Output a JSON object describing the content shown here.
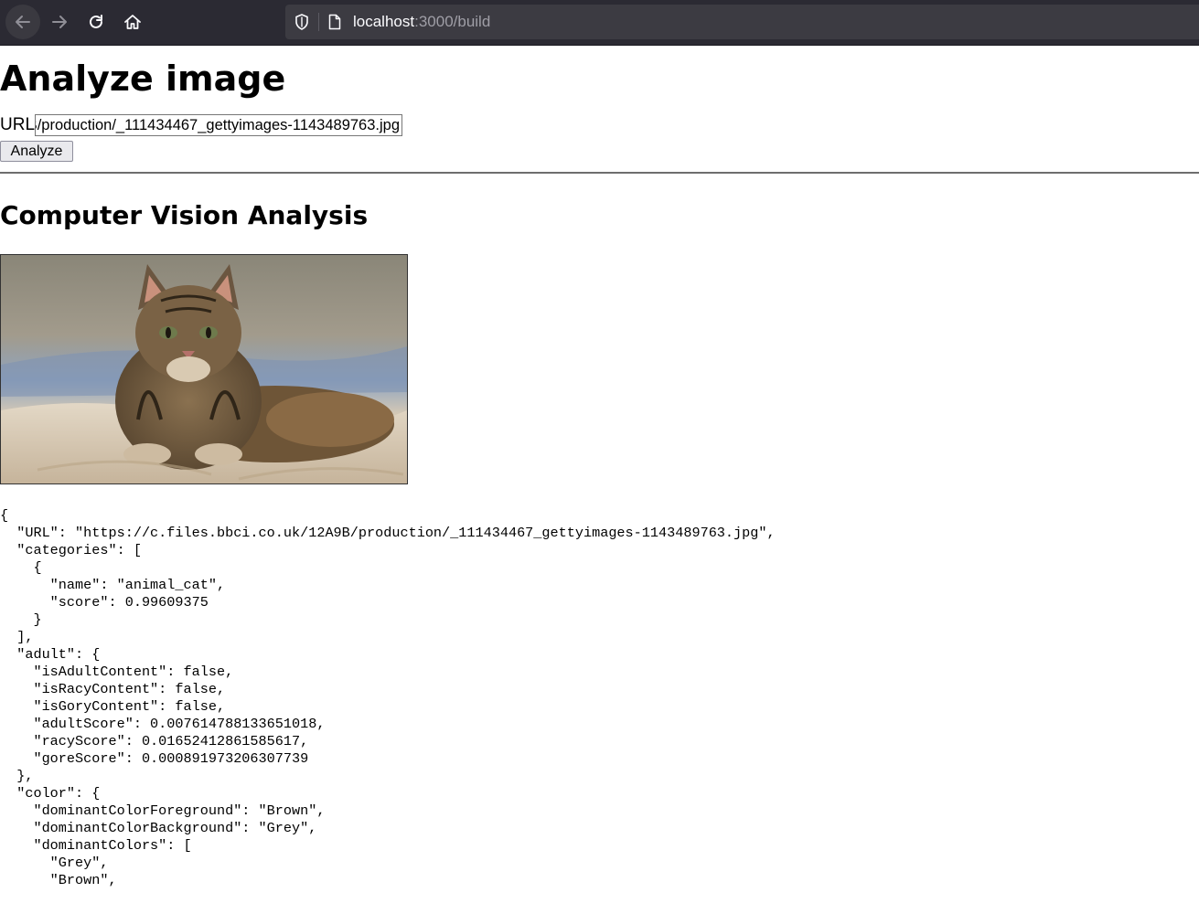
{
  "browser": {
    "url_host": "localhost",
    "url_rest": ":3000/build"
  },
  "page": {
    "title": "Analyze image",
    "url_label": "URL",
    "url_value": "https://c.files.bbci.co.uk/12A9B/production/_111434467_gettyimages-1143489763.jpg",
    "analyze_label": "Analyze",
    "section_title": "Computer Vision Analysis"
  },
  "result_json": "{\n  \"URL\": \"https://c.files.bbci.co.uk/12A9B/production/_111434467_gettyimages-1143489763.jpg\",\n  \"categories\": [\n    {\n      \"name\": \"animal_cat\",\n      \"score\": 0.99609375\n    }\n  ],\n  \"adult\": {\n    \"isAdultContent\": false,\n    \"isRacyContent\": false,\n    \"isGoryContent\": false,\n    \"adultScore\": 0.007614788133651018,\n    \"racyScore\": 0.01652412861585617,\n    \"goreScore\": 0.000891973206307739\n  },\n  \"color\": {\n    \"dominantColorForeground\": \"Brown\",\n    \"dominantColorBackground\": \"Grey\",\n    \"dominantColors\": [\n      \"Grey\",\n      \"Brown\","
}
